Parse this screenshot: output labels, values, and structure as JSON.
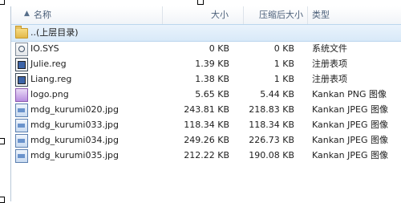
{
  "columns": {
    "name": "名称",
    "size": "大小",
    "compressed": "压缩后大小",
    "type": "类型"
  },
  "parent_folder": {
    "label": "..(上层目录)"
  },
  "files": [
    {
      "name": "IO.SYS",
      "size": "0 KB",
      "compressed": "0 KB",
      "type": "系统文件",
      "icon": "system-file-icon"
    },
    {
      "name": "Julie.reg",
      "size": "1.39 KB",
      "compressed": "1 KB",
      "type": "注册表项",
      "icon": "registry-file-icon"
    },
    {
      "name": "Liang.reg",
      "size": "1.38 KB",
      "compressed": "1 KB",
      "type": "注册表项",
      "icon": "registry-file-icon"
    },
    {
      "name": "logo.png",
      "size": "5.65 KB",
      "compressed": "5.44 KB",
      "type": "Kankan PNG 图像",
      "icon": "png-image-icon"
    },
    {
      "name": "mdg_kurumi020.jpg",
      "size": "243.81 KB",
      "compressed": "218.83 KB",
      "type": "Kankan JPEG 图像",
      "icon": "jpeg-image-icon"
    },
    {
      "name": "mdg_kurumi033.jpg",
      "size": "118.34 KB",
      "compressed": "118.34 KB",
      "type": "Kankan JPEG 图像",
      "icon": "jpeg-image-icon"
    },
    {
      "name": "mdg_kurumi034.jpg",
      "size": "249.26 KB",
      "compressed": "226.73 KB",
      "type": "Kankan JPEG 图像",
      "icon": "jpeg-image-icon"
    },
    {
      "name": "mdg_kurumi035.jpg",
      "size": "212.22 KB",
      "compressed": "190.08 KB",
      "type": "Kankan JPEG 图像",
      "icon": "jpeg-image-icon"
    }
  ]
}
